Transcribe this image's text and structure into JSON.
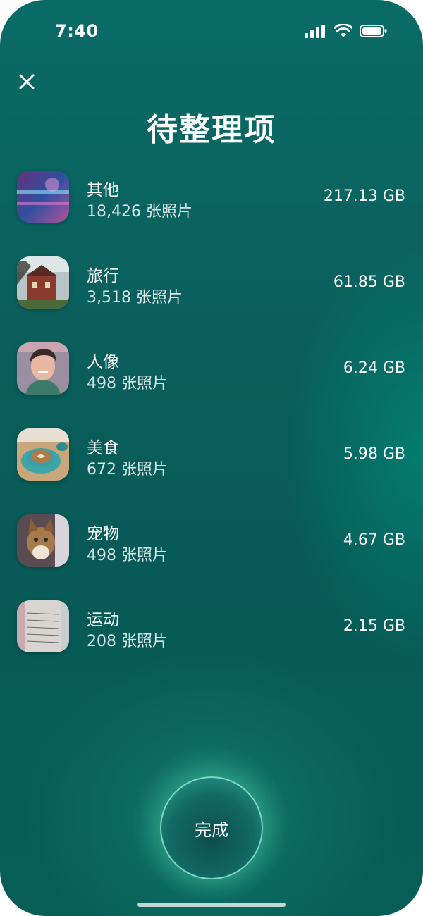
{
  "status": {
    "time": "7:40"
  },
  "header": {
    "title": "待整理项"
  },
  "categories": [
    {
      "title": "其他",
      "count": "18,426 张照片",
      "size": "217.13 GB"
    },
    {
      "title": "旅行",
      "count": "3,518 张照片",
      "size": "61.85 GB"
    },
    {
      "title": "人像",
      "count": "498 张照片",
      "size": "6.24 GB"
    },
    {
      "title": "美食",
      "count": "672 张照片",
      "size": "5.98 GB"
    },
    {
      "title": "宠物",
      "count": "498 张照片",
      "size": "4.67 GB"
    },
    {
      "title": "运动",
      "count": "208 张照片",
      "size": "2.15 GB"
    }
  ],
  "footer": {
    "done_label": "完成"
  },
  "icons": {
    "close": "close-icon",
    "signal": "cellular-signal-icon",
    "wifi": "wifi-icon",
    "battery": "battery-icon"
  },
  "colors": {
    "background": "#0a6b66",
    "accent": "#2fa690",
    "text": "#ffffff"
  }
}
